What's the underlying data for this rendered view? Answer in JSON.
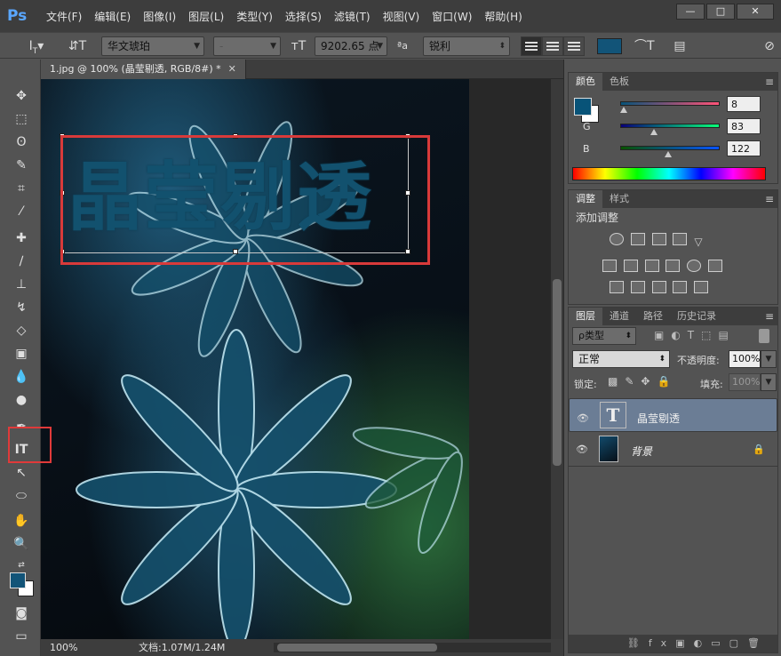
{
  "app": {
    "logo": "Ps",
    "menu": [
      "文件(F)",
      "编辑(E)",
      "图像(I)",
      "图层(L)",
      "类型(Y)",
      "选择(S)",
      "滤镜(T)",
      "视图(V)",
      "窗口(W)",
      "帮助(H)"
    ],
    "window_controls": [
      "—",
      "□",
      "✕"
    ]
  },
  "options": {
    "font_family": "华文琥珀",
    "font_style": "-",
    "font_size": "9202.65 点",
    "aa_label": "ªa",
    "antialias": "锐利",
    "text_color": "#125478"
  },
  "document": {
    "tab_title": "1.jpg @ 100% (晶莹剔透, RGB/8#) *",
    "text_content": "晶莹剔透"
  },
  "status": {
    "zoom": "100%",
    "doc_info": "文档:1.07M/1.24M"
  },
  "color_panel": {
    "tabs": [
      "颜色",
      "色板"
    ],
    "r": "8",
    "g": "83",
    "b": "122",
    "r_label": "R",
    "g_label": "G",
    "b_label": "B",
    "fg_color": "#085378"
  },
  "adjust_panel": {
    "tabs": [
      "调整",
      "样式"
    ],
    "title": "添加调整"
  },
  "layers_panel": {
    "tabs": [
      "图层",
      "通道",
      "路径",
      "历史记录"
    ],
    "filter_label": "ρ类型",
    "blend_mode": "正常",
    "opacity_label": "不透明度:",
    "opacity_value": "100%",
    "lock_label": "锁定:",
    "fill_label": "填充:",
    "fill_value": "100%",
    "layers": [
      {
        "name": "晶莹剔透",
        "type": "text"
      },
      {
        "name": "背景",
        "type": "image"
      }
    ]
  }
}
